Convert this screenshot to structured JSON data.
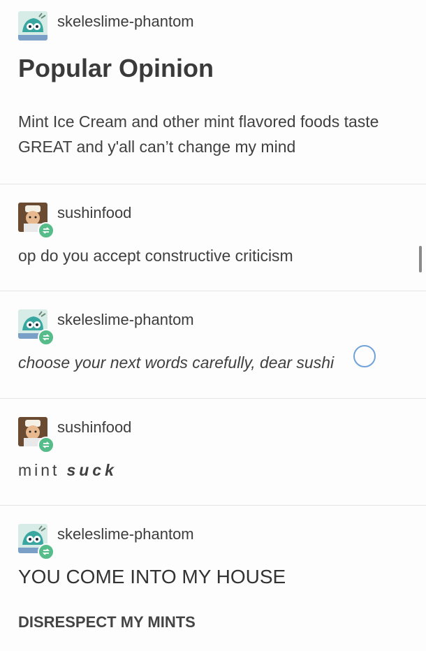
{
  "posts": [
    {
      "username": "skeleslime-phantom",
      "title": "Popular Opinion",
      "text_line1": "Mint Ice Cream and other mint flavored foods taste",
      "text_line2": "GREAT and y'all can’t change my mind",
      "avatar": "skeleton-slime-avatar"
    },
    {
      "username": "sushinfood",
      "text": "op do you accept constructive criticism",
      "avatar": "sushi-chef-avatar",
      "badge": "reblog-icon"
    },
    {
      "username": "skeleslime-phantom",
      "text": "choose your next words carefully, dear sushi",
      "avatar": "skeleton-slime-avatar",
      "badge": "reblog-icon"
    },
    {
      "username": "sushinfood",
      "text_part1": "mint",
      "text_part2": "suck",
      "avatar": "sushi-chef-avatar",
      "badge": "reblog-icon"
    },
    {
      "username": "skeleslime-phantom",
      "text_line1": "YOU COME INTO MY HOUSE",
      "text_line2": "DISRESPECT MY MINTS",
      "avatar": "skeleton-slime-avatar",
      "badge": "reblog-icon"
    }
  ],
  "colors": {
    "reblog_badge": "#56bc8a",
    "divider": "#e6e6e6",
    "spinner": "#6fa3d8"
  }
}
